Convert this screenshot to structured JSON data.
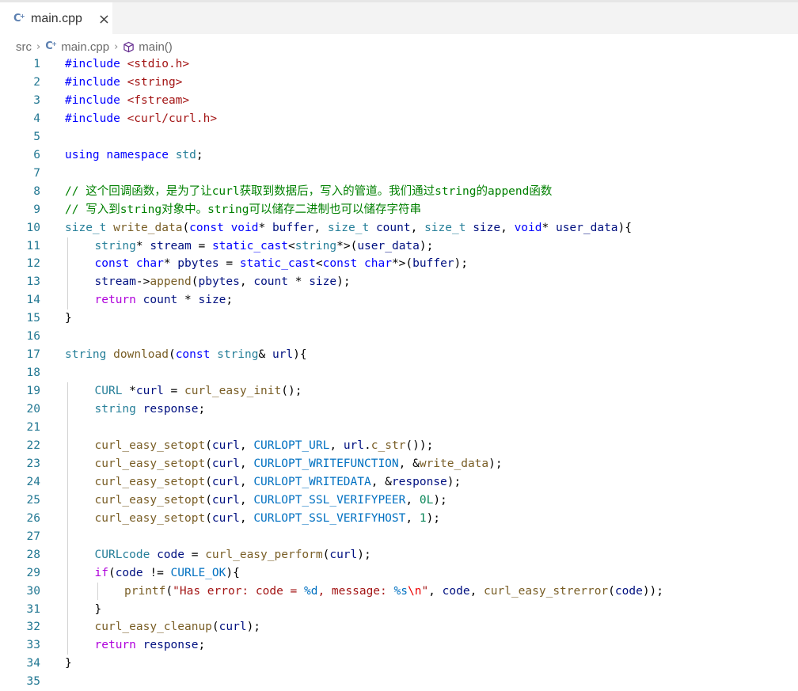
{
  "tab": {
    "icon": "cpp-file-icon",
    "label": "main.cpp",
    "close": "×"
  },
  "breadcrumb": {
    "folder": "src",
    "file": "main.cpp",
    "symbol": "main()"
  },
  "code_lines": [
    {
      "n": "1",
      "indent": 0,
      "tokens": [
        [
          "pp",
          "#include "
        ],
        [
          "s",
          "<stdio.h>"
        ]
      ]
    },
    {
      "n": "2",
      "indent": 0,
      "tokens": [
        [
          "pp",
          "#include "
        ],
        [
          "s",
          "<string>"
        ]
      ]
    },
    {
      "n": "3",
      "indent": 0,
      "tokens": [
        [
          "pp",
          "#include "
        ],
        [
          "s",
          "<fstream>"
        ]
      ]
    },
    {
      "n": "4",
      "indent": 0,
      "tokens": [
        [
          "pp",
          "#include "
        ],
        [
          "s",
          "<curl/curl.h>"
        ]
      ]
    },
    {
      "n": "5",
      "indent": 0,
      "tokens": []
    },
    {
      "n": "6",
      "indent": 0,
      "tokens": [
        [
          "k",
          "using"
        ],
        [
          "p",
          " "
        ],
        [
          "k",
          "namespace"
        ],
        [
          "p",
          " "
        ],
        [
          "t",
          "std"
        ],
        [
          "p",
          ";"
        ]
      ]
    },
    {
      "n": "7",
      "indent": 0,
      "tokens": []
    },
    {
      "n": "8",
      "indent": 0,
      "tokens": [
        [
          "c",
          "// 这个回调函数，是为了让curl获取到数据后，写入的管道。我们通过string的append函数"
        ]
      ]
    },
    {
      "n": "9",
      "indent": 0,
      "tokens": [
        [
          "c",
          "// 写入到string对象中。string可以储存二进制也可以储存字符串"
        ]
      ]
    },
    {
      "n": "10",
      "indent": 0,
      "tokens": [
        [
          "t",
          "size_t"
        ],
        [
          "p",
          " "
        ],
        [
          "f",
          "write_data"
        ],
        [
          "p",
          "("
        ],
        [
          "k",
          "const"
        ],
        [
          "p",
          " "
        ],
        [
          "k",
          "void"
        ],
        [
          "p",
          "* "
        ],
        [
          "v",
          "buffer"
        ],
        [
          "p",
          ", "
        ],
        [
          "t",
          "size_t"
        ],
        [
          "p",
          " "
        ],
        [
          "v",
          "count"
        ],
        [
          "p",
          ", "
        ],
        [
          "t",
          "size_t"
        ],
        [
          "p",
          " "
        ],
        [
          "v",
          "size"
        ],
        [
          "p",
          ", "
        ],
        [
          "k",
          "void"
        ],
        [
          "p",
          "* "
        ],
        [
          "v",
          "user_data"
        ],
        [
          "p",
          "){"
        ]
      ]
    },
    {
      "n": "11",
      "indent": 1,
      "tokens": [
        [
          "t",
          "string"
        ],
        [
          "p",
          "* "
        ],
        [
          "v",
          "stream"
        ],
        [
          "p",
          " = "
        ],
        [
          "k",
          "static_cast"
        ],
        [
          "p",
          "<"
        ],
        [
          "t",
          "string"
        ],
        [
          "p",
          "*>("
        ],
        [
          "v",
          "user_data"
        ],
        [
          "p",
          ");"
        ]
      ]
    },
    {
      "n": "12",
      "indent": 1,
      "tokens": [
        [
          "k",
          "const"
        ],
        [
          "p",
          " "
        ],
        [
          "k",
          "char"
        ],
        [
          "p",
          "* "
        ],
        [
          "v",
          "pbytes"
        ],
        [
          "p",
          " = "
        ],
        [
          "k",
          "static_cast"
        ],
        [
          "p",
          "<"
        ],
        [
          "k",
          "const"
        ],
        [
          "p",
          " "
        ],
        [
          "k",
          "char"
        ],
        [
          "p",
          "*>("
        ],
        [
          "v",
          "buffer"
        ],
        [
          "p",
          ");"
        ]
      ]
    },
    {
      "n": "13",
      "indent": 1,
      "tokens": [
        [
          "v",
          "stream"
        ],
        [
          "p",
          "->"
        ],
        [
          "f",
          "append"
        ],
        [
          "p",
          "("
        ],
        [
          "v",
          "pbytes"
        ],
        [
          "p",
          ", "
        ],
        [
          "v",
          "count"
        ],
        [
          "p",
          " * "
        ],
        [
          "v",
          "size"
        ],
        [
          "p",
          ");"
        ]
      ]
    },
    {
      "n": "14",
      "indent": 1,
      "tokens": [
        [
          "cf",
          "return"
        ],
        [
          "p",
          " "
        ],
        [
          "v",
          "count"
        ],
        [
          "p",
          " * "
        ],
        [
          "v",
          "size"
        ],
        [
          "p",
          ";"
        ]
      ]
    },
    {
      "n": "15",
      "indent": 0,
      "tokens": [
        [
          "p",
          "}"
        ]
      ]
    },
    {
      "n": "16",
      "indent": 0,
      "tokens": []
    },
    {
      "n": "17",
      "indent": 0,
      "tokens": [
        [
          "t",
          "string"
        ],
        [
          "p",
          " "
        ],
        [
          "f",
          "download"
        ],
        [
          "p",
          "("
        ],
        [
          "k",
          "const"
        ],
        [
          "p",
          " "
        ],
        [
          "t",
          "string"
        ],
        [
          "p",
          "& "
        ],
        [
          "v",
          "url"
        ],
        [
          "p",
          "){"
        ]
      ]
    },
    {
      "n": "18",
      "indent": 0,
      "tokens": []
    },
    {
      "n": "19",
      "indent": 1,
      "tokens": [
        [
          "t",
          "CURL"
        ],
        [
          "p",
          " *"
        ],
        [
          "v",
          "curl"
        ],
        [
          "p",
          " = "
        ],
        [
          "f",
          "curl_easy_init"
        ],
        [
          "p",
          "();"
        ]
      ]
    },
    {
      "n": "20",
      "indent": 1,
      "tokens": [
        [
          "t",
          "string"
        ],
        [
          "p",
          " "
        ],
        [
          "v",
          "response"
        ],
        [
          "p",
          ";"
        ]
      ]
    },
    {
      "n": "21",
      "indent": 0,
      "tokens": []
    },
    {
      "n": "22",
      "indent": 1,
      "tokens": [
        [
          "f",
          "curl_easy_setopt"
        ],
        [
          "p",
          "("
        ],
        [
          "v",
          "curl"
        ],
        [
          "p",
          ", "
        ],
        [
          "m",
          "CURLOPT_URL"
        ],
        [
          "p",
          ", "
        ],
        [
          "v",
          "url"
        ],
        [
          "p",
          "."
        ],
        [
          "f",
          "c_str"
        ],
        [
          "p",
          "());"
        ]
      ]
    },
    {
      "n": "23",
      "indent": 1,
      "tokens": [
        [
          "f",
          "curl_easy_setopt"
        ],
        [
          "p",
          "("
        ],
        [
          "v",
          "curl"
        ],
        [
          "p",
          ", "
        ],
        [
          "m",
          "CURLOPT_WRITEFUNCTION"
        ],
        [
          "p",
          ", &"
        ],
        [
          "f",
          "write_data"
        ],
        [
          "p",
          ");"
        ]
      ]
    },
    {
      "n": "24",
      "indent": 1,
      "tokens": [
        [
          "f",
          "curl_easy_setopt"
        ],
        [
          "p",
          "("
        ],
        [
          "v",
          "curl"
        ],
        [
          "p",
          ", "
        ],
        [
          "m",
          "CURLOPT_WRITEDATA"
        ],
        [
          "p",
          ", &"
        ],
        [
          "v",
          "response"
        ],
        [
          "p",
          ");"
        ]
      ]
    },
    {
      "n": "25",
      "indent": 1,
      "tokens": [
        [
          "f",
          "curl_easy_setopt"
        ],
        [
          "p",
          "("
        ],
        [
          "v",
          "curl"
        ],
        [
          "p",
          ", "
        ],
        [
          "m",
          "CURLOPT_SSL_VERIFYPEER"
        ],
        [
          "p",
          ", "
        ],
        [
          "n",
          "0L"
        ],
        [
          "p",
          ");"
        ]
      ]
    },
    {
      "n": "26",
      "indent": 1,
      "tokens": [
        [
          "f",
          "curl_easy_setopt"
        ],
        [
          "p",
          "("
        ],
        [
          "v",
          "curl"
        ],
        [
          "p",
          ", "
        ],
        [
          "m",
          "CURLOPT_SSL_VERIFYHOST"
        ],
        [
          "p",
          ", "
        ],
        [
          "n",
          "1"
        ],
        [
          "p",
          ");"
        ]
      ]
    },
    {
      "n": "27",
      "indent": 0,
      "tokens": []
    },
    {
      "n": "28",
      "indent": 1,
      "tokens": [
        [
          "t",
          "CURLcode"
        ],
        [
          "p",
          " "
        ],
        [
          "v",
          "code"
        ],
        [
          "p",
          " = "
        ],
        [
          "f",
          "curl_easy_perform"
        ],
        [
          "p",
          "("
        ],
        [
          "v",
          "curl"
        ],
        [
          "p",
          ");"
        ]
      ]
    },
    {
      "n": "29",
      "indent": 1,
      "tokens": [
        [
          "cf",
          "if"
        ],
        [
          "p",
          "("
        ],
        [
          "v",
          "code"
        ],
        [
          "p",
          " != "
        ],
        [
          "m",
          "CURLE_OK"
        ],
        [
          "p",
          "){"
        ]
      ]
    },
    {
      "n": "30",
      "indent": 2,
      "tokens": [
        [
          "f",
          "printf"
        ],
        [
          "p",
          "("
        ],
        [
          "s",
          "\"Has error: code = "
        ],
        [
          "m",
          "%d"
        ],
        [
          "s",
          ", message: "
        ],
        [
          "m",
          "%s"
        ],
        [
          "e",
          "\\n"
        ],
        [
          "s",
          "\""
        ],
        [
          "p",
          ", "
        ],
        [
          "v",
          "code"
        ],
        [
          "p",
          ", "
        ],
        [
          "f",
          "curl_easy_strerror"
        ],
        [
          "p",
          "("
        ],
        [
          "v",
          "code"
        ],
        [
          "p",
          "));"
        ]
      ]
    },
    {
      "n": "31",
      "indent": 1,
      "tokens": [
        [
          "p",
          "}"
        ]
      ]
    },
    {
      "n": "32",
      "indent": 1,
      "tokens": [
        [
          "f",
          "curl_easy_cleanup"
        ],
        [
          "p",
          "("
        ],
        [
          "v",
          "curl"
        ],
        [
          "p",
          ");"
        ]
      ]
    },
    {
      "n": "33",
      "indent": 1,
      "tokens": [
        [
          "cf",
          "return"
        ],
        [
          "p",
          " "
        ],
        [
          "v",
          "response"
        ],
        [
          "p",
          ";"
        ]
      ]
    },
    {
      "n": "34",
      "indent": 0,
      "tokens": [
        [
          "p",
          "}"
        ]
      ]
    },
    {
      "n": "35",
      "indent": 0,
      "tokens": []
    }
  ],
  "colors": {
    "keyword": "#0000ff",
    "string": "#a31515",
    "comment": "#008000",
    "type": "#267f99",
    "function": "#795e26",
    "variable": "#001080",
    "constant": "#0070c1",
    "number": "#098658",
    "control": "#af00db",
    "line_number": "#237893"
  }
}
